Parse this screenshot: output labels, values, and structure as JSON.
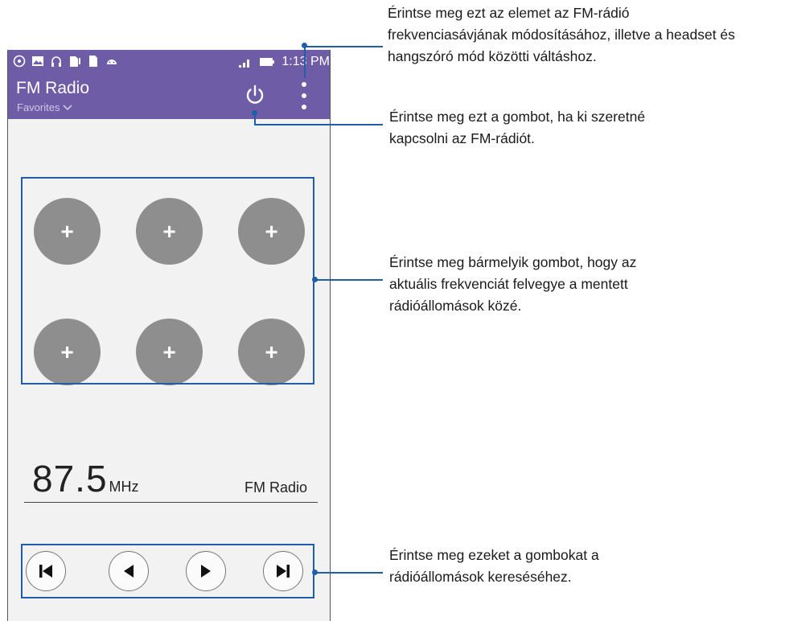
{
  "status_bar": {
    "time": "1:13 PM"
  },
  "app_bar": {
    "title": "FM Radio",
    "subtitle": "Favorites",
    "power_icon": "power-icon",
    "menu_icon": "overflow-menu-icon"
  },
  "favorites": [
    {
      "label": "+"
    },
    {
      "label": "+"
    },
    {
      "label": "+"
    },
    {
      "label": "+"
    },
    {
      "label": "+"
    },
    {
      "label": "+"
    }
  ],
  "tuner": {
    "frequency": "87.5",
    "unit": "MHz",
    "station": "FM Radio"
  },
  "controls": [
    {
      "icon": "skip-previous-icon"
    },
    {
      "icon": "seek-back-icon"
    },
    {
      "icon": "seek-forward-icon"
    },
    {
      "icon": "skip-next-icon"
    }
  ],
  "callouts": {
    "menu": "Érintse meg ezt az elemet az FM-rádió\nfrekvenciasávjának módosításához, illetve a headset és\nhangszóró mód közötti váltáshoz.",
    "power": "Érintse meg ezt a gombot, ha ki szeretné\nkapcsolni az FM-rádiót.",
    "favorites": "Érintse meg bármelyik gombot, hogy az\naktuális frekvenciát felvegye a mentett\nrádióállomások közé.",
    "controls": "Érintse meg ezeket a gombokat a\nrádióállomások kereséséhez."
  },
  "colors": {
    "app_bar": "#6f5ca6",
    "callout_line": "#1f5ea8",
    "favorite_button": "#8e8e8e"
  }
}
